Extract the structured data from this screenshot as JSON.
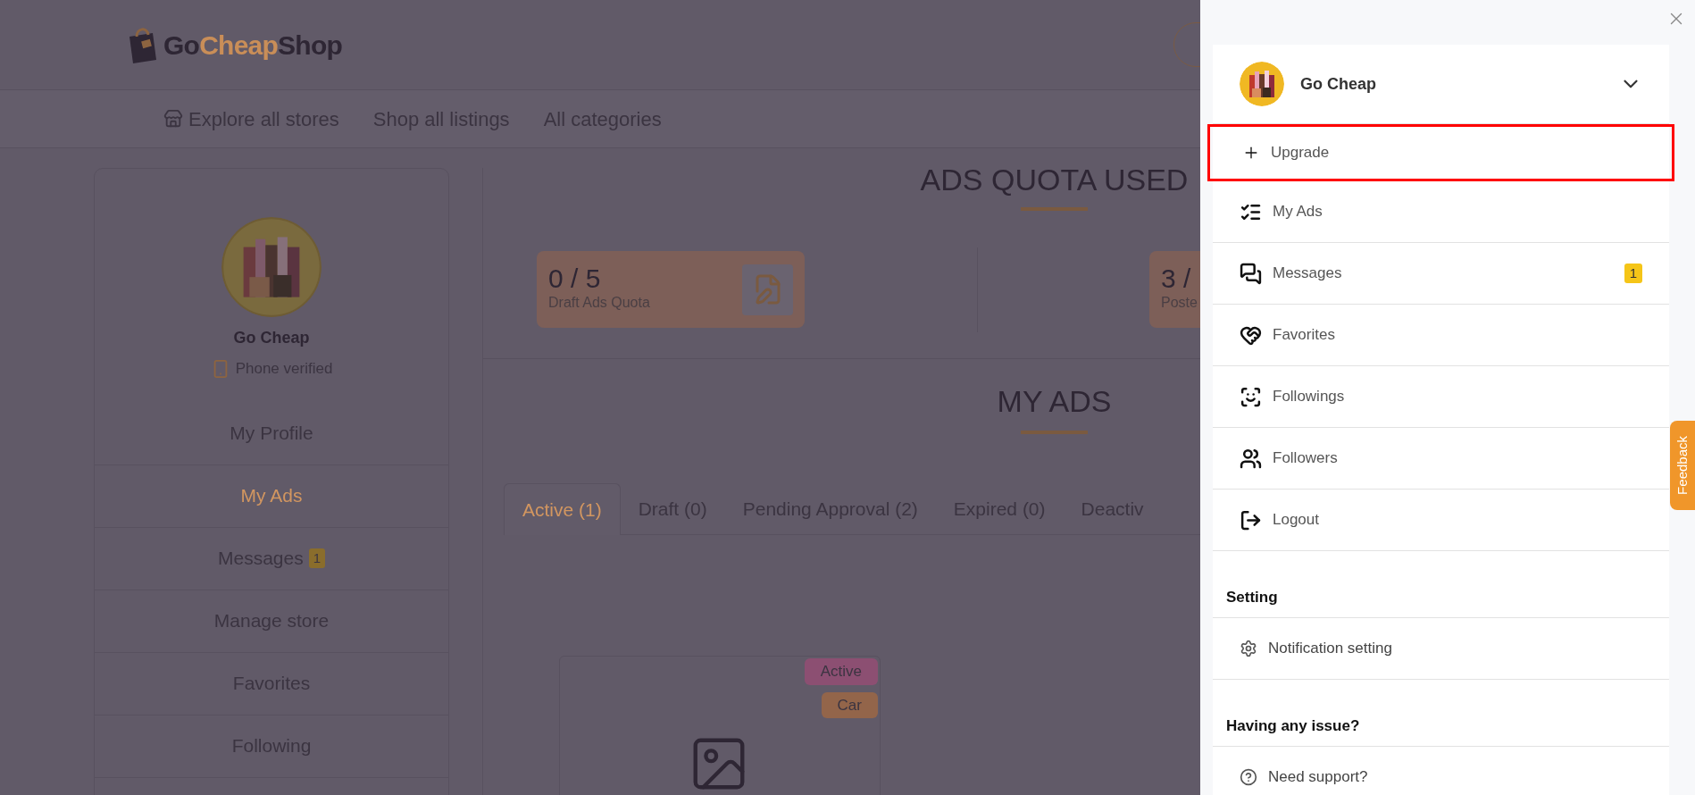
{
  "header": {
    "logo": [
      {
        "text": "Go",
        "color": "#2e2634"
      },
      {
        "text": "Cheap",
        "color": "#c98e58"
      },
      {
        "text": "Shop",
        "color": "#2e2634"
      }
    ],
    "nav": [
      "Explore all stores",
      "Shop all listings",
      "All categories"
    ]
  },
  "sidebar": {
    "name": "Go Cheap",
    "phone_status": "Phone verified",
    "items": [
      {
        "label": "My Profile",
        "selected": false
      },
      {
        "label": "My Ads",
        "selected": true
      },
      {
        "label": "Messages",
        "selected": false,
        "badge": "1"
      },
      {
        "label": "Manage store",
        "selected": false
      },
      {
        "label": "Favorites",
        "selected": false
      },
      {
        "label": "Following",
        "selected": false
      }
    ]
  },
  "main": {
    "quota_title": "ADS QUOTA USED",
    "quota_cards": [
      {
        "value": "0 / 5",
        "label": "Draft Ads Quota"
      },
      {
        "value": "3 /",
        "label": "Poste"
      }
    ],
    "ads_title": "MY ADS",
    "tabs": [
      {
        "label": "Active (1)",
        "selected": true
      },
      {
        "label": "Draft (0)",
        "selected": false
      },
      {
        "label": "Pending Approval (2)",
        "selected": false
      },
      {
        "label": "Expired (0)",
        "selected": false
      },
      {
        "label": "Deactiv",
        "selected": false
      }
    ],
    "ad_card": {
      "badges": [
        {
          "text": "Active",
          "color": "#8c4f72"
        },
        {
          "text": "Car",
          "color": "#93654a"
        }
      ]
    }
  },
  "drawer": {
    "user": {
      "name": "Go Cheap"
    },
    "items": [
      {
        "label": "Upgrade",
        "highlighted": true
      },
      {
        "label": "My Ads",
        "highlighted": false
      },
      {
        "label": "Messages",
        "highlighted": false,
        "badge": "1"
      },
      {
        "label": "Favorites",
        "highlighted": false
      },
      {
        "label": "Followings",
        "highlighted": false
      },
      {
        "label": "Followers",
        "highlighted": false
      },
      {
        "label": "Logout",
        "highlighted": false
      }
    ],
    "sections": [
      {
        "heading": "Setting",
        "items": [
          "Notification setting"
        ]
      },
      {
        "heading": "Having any issue?",
        "items": [
          "Need support?"
        ]
      }
    ]
  },
  "feedback": "Feedback"
}
